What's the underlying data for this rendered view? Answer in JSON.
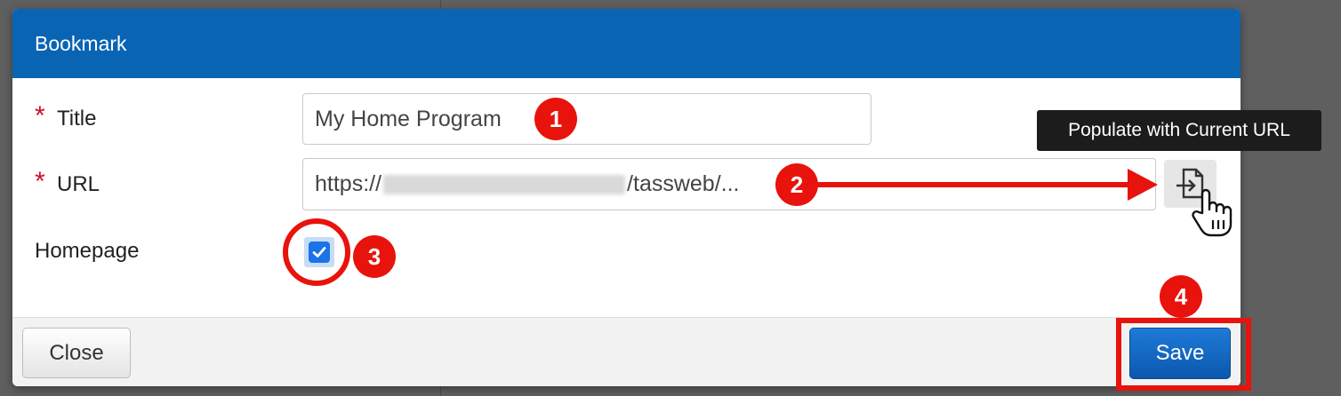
{
  "dialog": {
    "title": "Bookmark"
  },
  "form": {
    "title_label": "Title",
    "title_value": "My Home Program",
    "url_label": "URL",
    "url_prefix": "https://",
    "url_suffix": "/tassweb/...",
    "homepage_label": "Homepage",
    "homepage_checked": true,
    "required_marker": "*"
  },
  "populate": {
    "tooltip": "Populate with Current URL",
    "icon": "populate-url-icon"
  },
  "footer": {
    "close_label": "Close",
    "save_label": "Save"
  },
  "annotations": {
    "step1": "1",
    "step2": "2",
    "step3": "3",
    "step4": "4",
    "color": "#e8130c"
  },
  "colors": {
    "header": "#0a64b4",
    "save": "#0b58ad",
    "checkbox": "#1a73e8"
  }
}
